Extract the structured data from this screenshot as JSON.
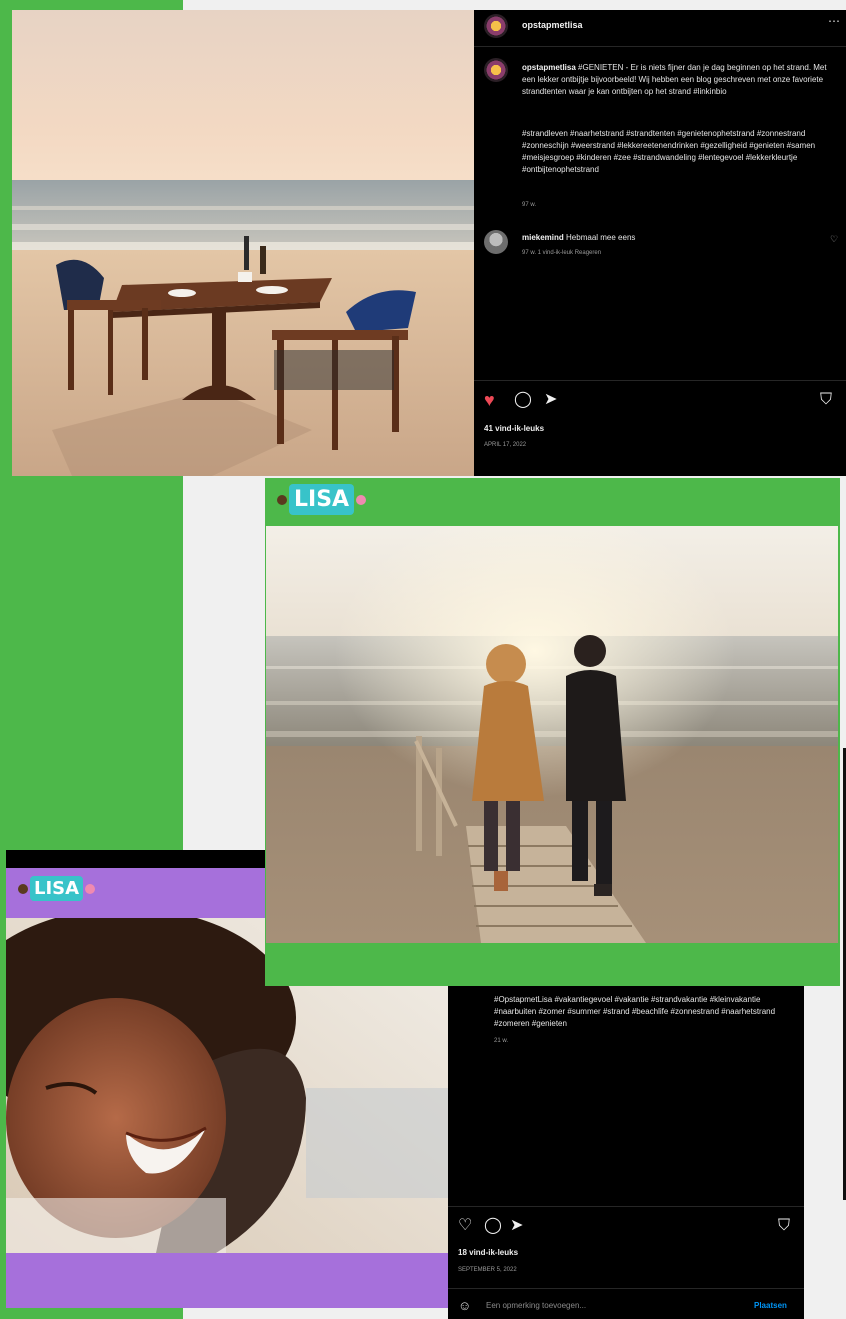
{
  "post1": {
    "username": "opstapmetlisa",
    "more_icon": "more-horizontal-icon",
    "caption_user": "opstapmetlisa",
    "caption_text": "#GENIETEN - Er is niets fijner dan je dag beginnen op het strand. Met een lekker ontbijtje bijvoorbeeld! Wij hebben een blog geschreven met onze favoriete strandtenten waar je kan ontbijten op het strand #linkinbio",
    "hashtags": "#strandleven #naarhetstrand #strandtenten #genietenophetstrand #zonnestrand #zonneschijn #weerstrand #lekkereetenendrinken #gezelligheid #genieten #samen #meisjesgroep #kinderen #zee #strandwandeling #lentegevoel #lekkerkleurtje #ontbijtenophetstrand",
    "caption_time": "97 w.",
    "comment_user": "miekemind",
    "comment_text": "Hebmaal mee eens",
    "comment_meta": "97 w.   1 vind-ik-leuk   Reageren",
    "likes": "41 vind-ik-leuks",
    "date": "APRIL 17, 2022"
  },
  "post2": {
    "logo_text": "LISA"
  },
  "post3": {
    "logo_text": "LISA",
    "hashtags": "#OpstapmetLisa #vakantiegevoel #vakantie #strandvakantie #kleinvakantie #naarbuiten #zomer #summer #strand #beachlife #zonnestrand #naarhetstrand #zomeren #genieten",
    "time": "21 w.",
    "likes": "18 vind-ik-leuks",
    "date": "SEPTEMBER 5, 2022",
    "comment_placeholder": "Een opmerking toevoegen...",
    "post_button": "Plaatsen"
  },
  "colors": {
    "green": "#4db84a",
    "purple": "#a670db",
    "like_red": "#ed4956",
    "link_blue": "#0095f6",
    "logo_teal": "#38c3c9"
  }
}
